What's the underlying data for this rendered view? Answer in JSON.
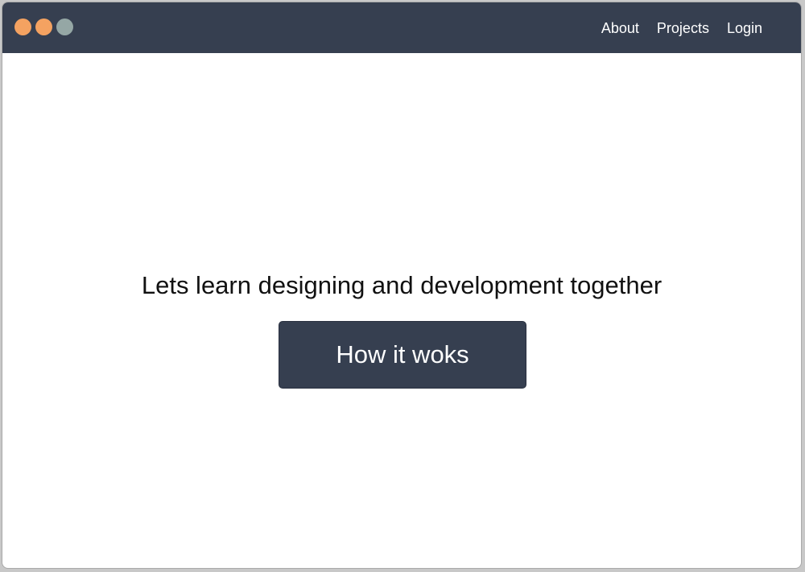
{
  "window": {
    "controls": [
      {
        "name": "window-dot-1",
        "color": "#f4a261"
      },
      {
        "name": "window-dot-2",
        "color": "#f4a261"
      },
      {
        "name": "window-dot-3",
        "color": "#95a7a5"
      }
    ]
  },
  "nav": {
    "items": [
      {
        "label": "About"
      },
      {
        "label": "Projects"
      },
      {
        "label": "Login"
      }
    ]
  },
  "hero": {
    "headline": "Lets learn designing and development together",
    "cta_label": "How it woks"
  },
  "colors": {
    "header_bg": "#363f50",
    "button_bg": "#363f50",
    "page_bg": "#ffffff"
  }
}
